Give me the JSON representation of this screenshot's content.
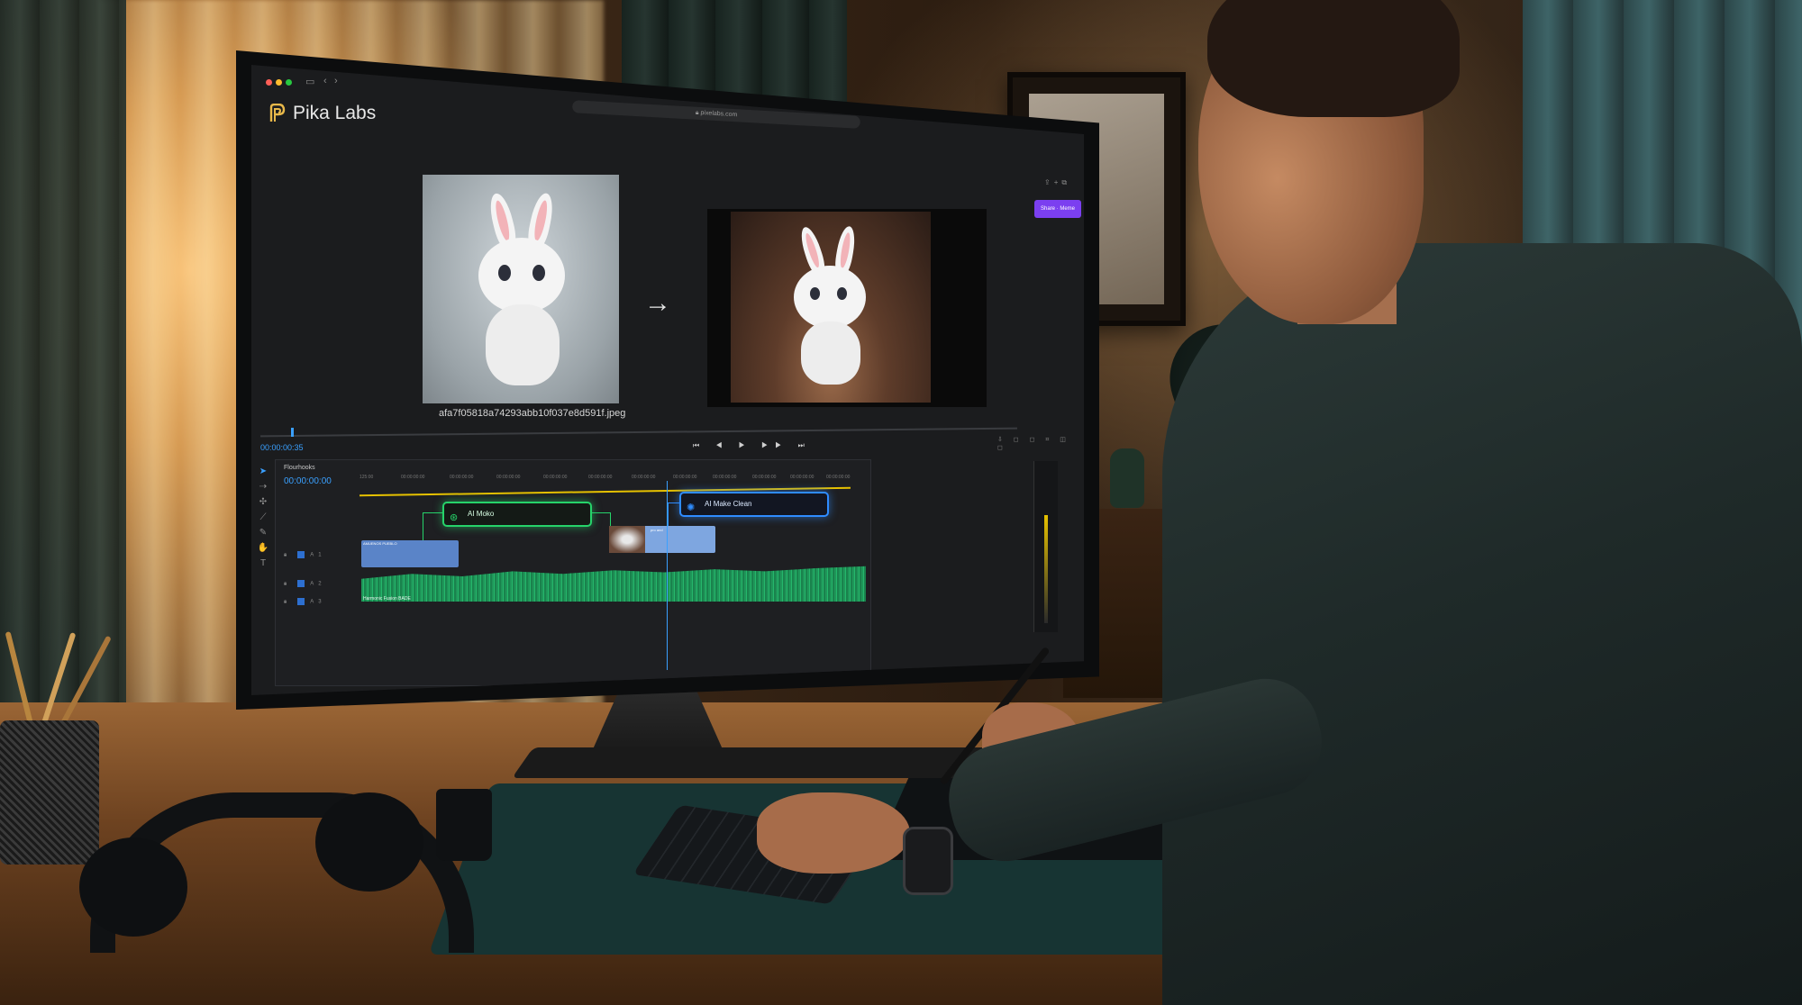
{
  "app": {
    "name": "Pika Labs",
    "url": "pixelabs.com",
    "primary_button": "Share · Meme",
    "brand_color": "#e8b84a",
    "accent_color": "#7b3ff0"
  },
  "preview": {
    "source_filename": "afa7f05818a74293abb10f037e8d591f.jpeg",
    "arrow": "→",
    "playback_time": "00:00:00:35"
  },
  "transport": {
    "controls": "⏮ ◀ ▶ ▶▶ ⏭"
  },
  "timeline": {
    "panel_title": "Flourhooks",
    "timecode": "00:00:00:00",
    "ruler": [
      "125:00",
      "00:00:00:00",
      "00:00:00:00",
      "00:00:00:00",
      "00:00:00:00",
      "00:00:00:00",
      "00:00:00:00",
      "00:00:00:00",
      "00:00:00:00",
      "00:00:00:00",
      "00:00:00:00",
      "00:00:00:00"
    ],
    "node_green": "AI Moko",
    "node_blue": "AI Make Clean",
    "clip_a": "AMUENOS PUEBLO",
    "clip_b": "pro and",
    "audio_label": "Harmonic Fusion BADE",
    "track_a": "A1",
    "track_b": "A2",
    "track_c": "A3"
  },
  "icons": {
    "logo": "pika-logo-icon",
    "arrow": "arrow-right-icon",
    "node_green": "ai-search-icon",
    "node_blue": "ai-sparkle-icon"
  }
}
